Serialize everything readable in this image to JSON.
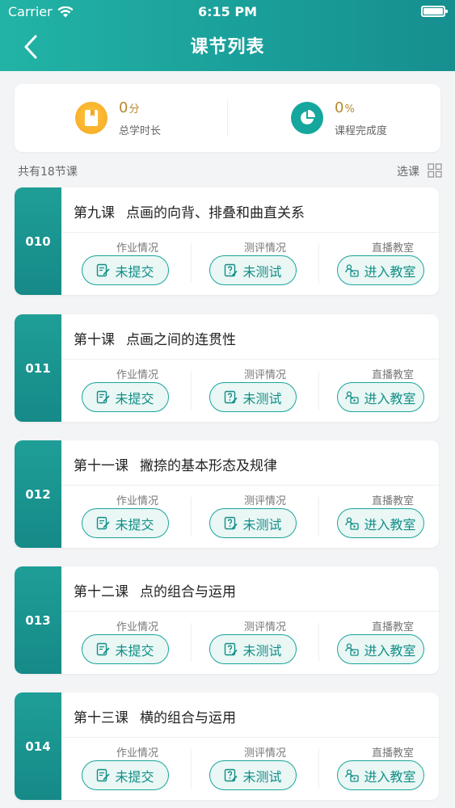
{
  "status_bar": {
    "carrier": "Carrier",
    "time": "6:15 PM"
  },
  "nav": {
    "title": "课节列表",
    "back_icon": "chevron-left-icon"
  },
  "summary": {
    "study_time": {
      "value": "0",
      "unit": "分",
      "label": "总学时长",
      "icon": "book-icon",
      "color": "#f5a623"
    },
    "completion": {
      "value": "0",
      "unit": "%",
      "label": "课程完成度",
      "icon": "pie-chart-icon",
      "color": "#15a79d"
    }
  },
  "list_meta": {
    "total": "共有18节课",
    "select_label": "选课",
    "grid_icon": "grid-icon"
  },
  "columns": {
    "homework": "作业情况",
    "test": "测评情况",
    "live": "直播教室"
  },
  "lessons": [
    {
      "code": "010",
      "number": "第九课",
      "name": "点画的向背、排叠和曲直关系",
      "homework": "未提交",
      "test": "未测试",
      "live": "进入教室"
    },
    {
      "code": "011",
      "number": "第十课",
      "name": "点画之间的连贯性",
      "homework": "未提交",
      "test": "未测试",
      "live": "进入教室"
    },
    {
      "code": "012",
      "number": "第十一课",
      "name": "撇捺的基本形态及规律",
      "homework": "未提交",
      "test": "未测试",
      "live": "进入教室"
    },
    {
      "code": "013",
      "number": "第十二课",
      "name": "点的组合与运用",
      "homework": "未提交",
      "test": "未测试",
      "live": "进入教室"
    },
    {
      "code": "014",
      "number": "第十三课",
      "name": "横的组合与运用",
      "homework": "未提交",
      "test": "未测试",
      "live": "进入教室"
    }
  ],
  "theme": {
    "primary": "#1a9f9a",
    "accent": "#b7882f",
    "background": "#f3f4f6"
  }
}
